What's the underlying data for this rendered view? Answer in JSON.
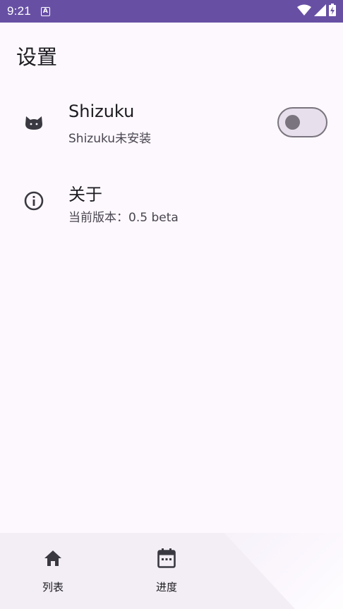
{
  "status_bar": {
    "time": "9:21",
    "notification_badge": "A",
    "icons": [
      "wifi-icon",
      "signal-icon",
      "battery-charging-icon"
    ]
  },
  "page": {
    "title": "设置"
  },
  "settings": [
    {
      "icon": "cat-icon",
      "title": "Shizuku",
      "subtitle": "Shizuku未安装",
      "switch_on": false
    },
    {
      "icon": "info-icon",
      "title": "关于",
      "subtitle": "当前版本：0.5 beta"
    }
  ],
  "bottom_nav": {
    "items": [
      {
        "icon": "home-icon",
        "label": "列表"
      },
      {
        "icon": "calendar-icon",
        "label": "进度"
      }
    ]
  },
  "colors": {
    "status_bar": "#6750a4",
    "background": "#fdf8fe",
    "nav_background": "#f3eef6",
    "switch_track": "#e7e0ec",
    "switch_outline": "#79747e"
  }
}
